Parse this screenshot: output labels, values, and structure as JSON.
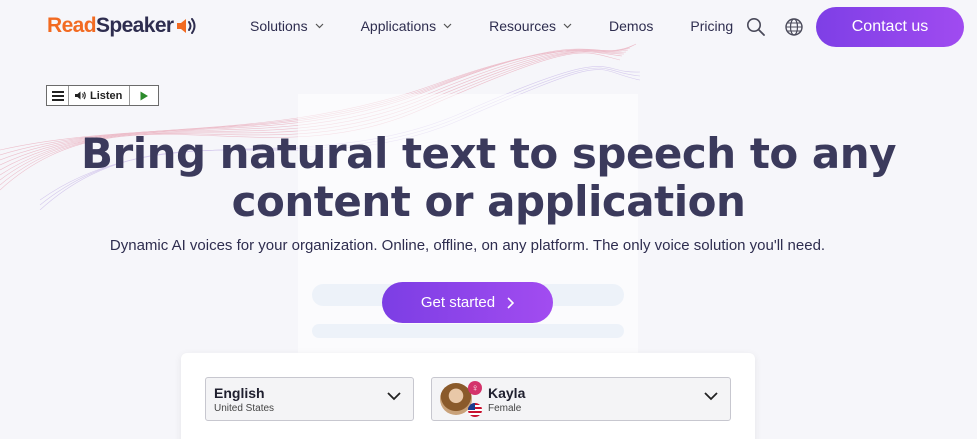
{
  "header": {
    "logo": {
      "part1": "Read",
      "part2": "Speaker",
      "icon": "speaker-icon"
    },
    "nav": [
      {
        "label": "Solutions",
        "has_dropdown": true
      },
      {
        "label": "Applications",
        "has_dropdown": true
      },
      {
        "label": "Resources",
        "has_dropdown": true
      },
      {
        "label": "Demos",
        "has_dropdown": false
      },
      {
        "label": "Pricing",
        "has_dropdown": false
      }
    ],
    "search_icon": "search-icon",
    "language_icon": "globe-icon",
    "contact_label": "Contact us"
  },
  "listen_widget": {
    "menu_icon": "menu-icon",
    "label": "Listen",
    "play_icon": "play-icon"
  },
  "hero": {
    "title_line1": "Bring natural text to speech to any",
    "title_line2": "content or application",
    "subtitle": "Dynamic AI voices for your organization. Online, offline, on any platform. The only voice solution you'll need.",
    "cta_label": "Get started"
  },
  "demo": {
    "language": {
      "value": "English",
      "region": "United States"
    },
    "voice": {
      "name": "Kayla",
      "gender": "Female"
    }
  },
  "colors": {
    "brand_orange": "#f26a21",
    "brand_purple": "#8b44ea",
    "text_dark": "#3b3a5c",
    "background": "#f6f6fa"
  }
}
